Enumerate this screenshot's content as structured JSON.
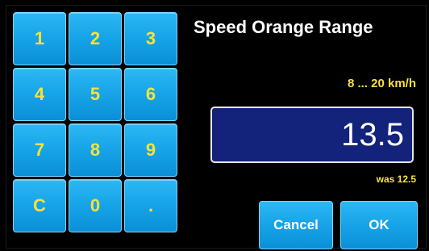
{
  "dialog": {
    "title": "Speed Orange Range",
    "range_label": "8 ... 20 km/h",
    "value": "13.5",
    "previous_label": "was 12.5"
  },
  "keypad": {
    "keys": [
      "1",
      "2",
      "3",
      "4",
      "5",
      "6",
      "7",
      "8",
      "9",
      "C",
      "0",
      "."
    ]
  },
  "actions": {
    "cancel_label": "Cancel",
    "ok_label": "OK"
  },
  "colors": {
    "key_face": "#16a3e8",
    "key_text": "#f7e23a",
    "value_box": "#13227a",
    "background": "#000000"
  }
}
